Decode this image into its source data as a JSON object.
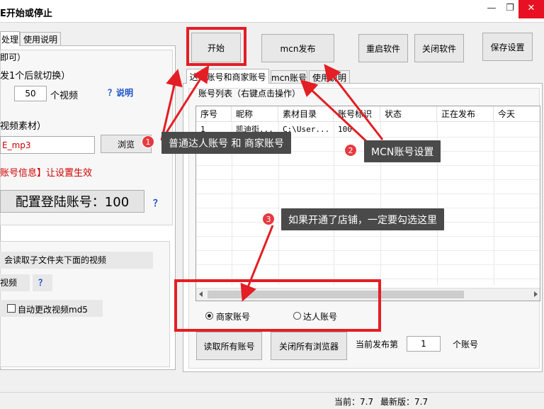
{
  "window": {
    "title": "E开始或停止",
    "minimize_glyph": "—",
    "restore_glyph": "❐",
    "close_glyph": "✕"
  },
  "left": {
    "tabs": [
      "处理",
      "使用说明"
    ],
    "group1_title": "即可）",
    "switch_text": "发1个后就切换）",
    "video_count_value": "50",
    "video_unit": "个视频",
    "help_link": "？说明",
    "material_label": "视频素材）",
    "material_path": "E_mp3",
    "browse_button": "浏览",
    "account_info_text": "账号信息】让设置生效",
    "config_accounts_button": "配置登陆账号：100",
    "question_mark": "？",
    "subfolder_text": "会读取子文件夹下面的视频",
    "video_button": "视频",
    "auto_md5_label": "自动更改视频md5"
  },
  "toolbar": {
    "start": "开始",
    "mcn_publish": "mcn发布",
    "restart": "重启软件",
    "close_app": "关闭软件",
    "save_settings": "保存设置"
  },
  "main_tabs": [
    "达人账号和商家账号",
    "mcn账号",
    "使用说明"
  ],
  "account_list": {
    "group_title": "账号列表（右键点击操作）",
    "columns": [
      "序号",
      "昵称",
      "素材目录",
      "账号标识",
      "状态",
      "正在发布",
      "今天"
    ],
    "rows": [
      [
        "1",
        "凯迪街...",
        "C:\\User...",
        "100",
        "",
        "",
        ""
      ]
    ]
  },
  "account_type": {
    "merchant": "商家账号",
    "creator": "达人账号",
    "selected": "商家账号"
  },
  "bottom": {
    "read_all": "读取所有账号",
    "close_browsers": "关闭所有浏览器",
    "current_label": "当前发布第",
    "current_value": "1",
    "current_unit": "个账号"
  },
  "annotations": [
    {
      "number": "1",
      "text": "普通达人账号 和 商家账号"
    },
    {
      "number": "2",
      "text": "MCN账号设置"
    },
    {
      "number": "3",
      "text": "如果开通了店铺，一定要勾选这里"
    }
  ],
  "status": {
    "current_version": "当前：7.7",
    "latest_version": "最新版：7.7"
  },
  "colors": {
    "highlight_red": "#e31e24",
    "callout_bg": "#4a4a4a",
    "badge_red": "#e7393f",
    "link_blue": "#1a53c9"
  }
}
